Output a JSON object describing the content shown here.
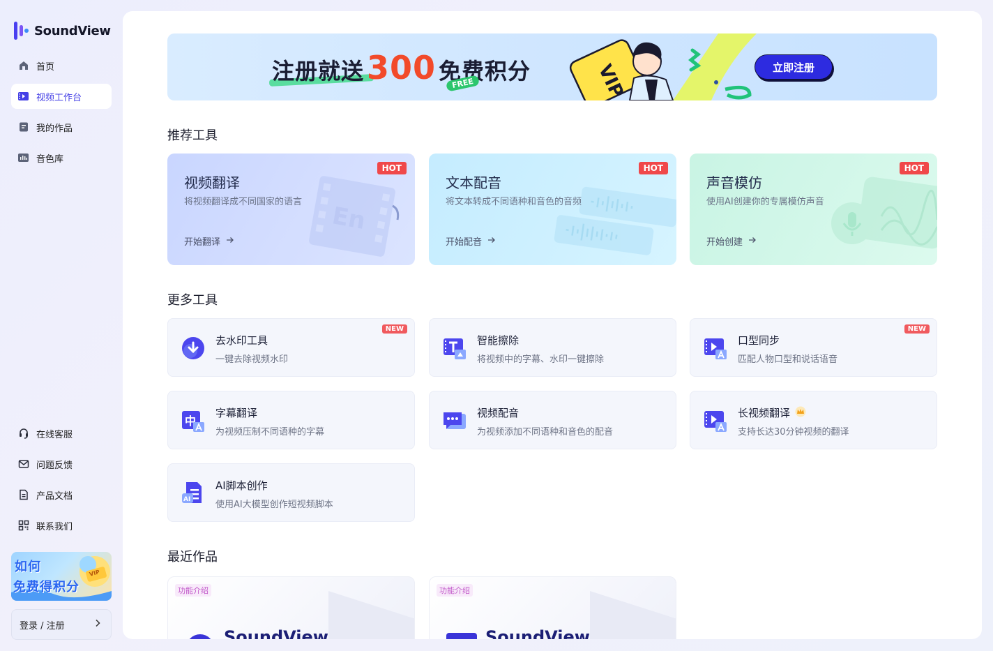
{
  "app": {
    "name": "SoundView"
  },
  "sidebar": {
    "items": [
      {
        "label": "首页",
        "icon": "home-icon"
      },
      {
        "label": "视频工作台",
        "icon": "video-workbench-icon",
        "active": true
      },
      {
        "label": "我的作品",
        "icon": "my-works-icon"
      },
      {
        "label": "音色库",
        "icon": "voice-library-icon"
      }
    ],
    "bottom_items": [
      {
        "label": "在线客服",
        "icon": "headset-icon"
      },
      {
        "label": "问题反馈",
        "icon": "mail-icon"
      },
      {
        "label": "产品文档",
        "icon": "document-icon"
      },
      {
        "label": "联系我们",
        "icon": "qrcode-icon"
      }
    ],
    "promo": {
      "line1": "如何",
      "line2": "免费得积分",
      "badge": "VIP"
    },
    "login": {
      "label": "登录 / 注册"
    }
  },
  "banner": {
    "title_prefix": "注册就送",
    "title_number": "300",
    "title_suffix": "免费积分",
    "free_tag": "FREE",
    "card_text": "VIP",
    "button": "立即注册"
  },
  "recommended": {
    "title": "推荐工具",
    "cards": [
      {
        "title": "视频翻译",
        "desc": "将视频翻译成不同国家的语言",
        "cta": "开始翻译",
        "badge": "HOT",
        "deco_text": "En"
      },
      {
        "title": "文本配音",
        "desc": "将文本转成不同语种和音色的音频",
        "cta": "开始配音",
        "badge": "HOT"
      },
      {
        "title": "声音模仿",
        "desc": "使用AI创建你的专属模仿声音",
        "cta": "开始创建",
        "badge": "HOT"
      }
    ]
  },
  "more": {
    "title": "更多工具",
    "tools": [
      {
        "name": "去水印工具",
        "desc": "一键去除视频水印",
        "badge": "NEW",
        "icon": "download-icon"
      },
      {
        "name": "智能擦除",
        "desc": "将视频中的字幕、水印一键擦除",
        "badge": "",
        "icon": "erase-icon"
      },
      {
        "name": "口型同步",
        "desc": "匹配人物口型和说话语音",
        "badge": "NEW",
        "icon": "lip-sync-icon"
      },
      {
        "name": "字幕翻译",
        "desc": "为视频压制不同语种的字幕",
        "badge": "",
        "icon": "subtitle-translate-icon"
      },
      {
        "name": "视频配音",
        "desc": "为视频添加不同语种和音色的配音",
        "badge": "",
        "icon": "video-dubbing-icon"
      },
      {
        "name": "长视频翻译",
        "desc": "支持长达30分钟视频的翻译",
        "badge": "",
        "icon": "long-video-icon",
        "crown": true
      },
      {
        "name": "AI脚本创作",
        "desc": "使用AI大模型创作短视频脚本",
        "badge": "",
        "icon": "ai-script-icon"
      }
    ]
  },
  "recent": {
    "title": "最近作品",
    "items": [
      {
        "tag": "功能介绍",
        "brand": "SoundView"
      },
      {
        "tag": "功能介绍",
        "brand": "SoundView"
      }
    ]
  },
  "colors": {
    "accent": "#4540e6",
    "hot": "#f0484a",
    "new": "#f05a5e",
    "banner_button": "#2d2be0"
  }
}
